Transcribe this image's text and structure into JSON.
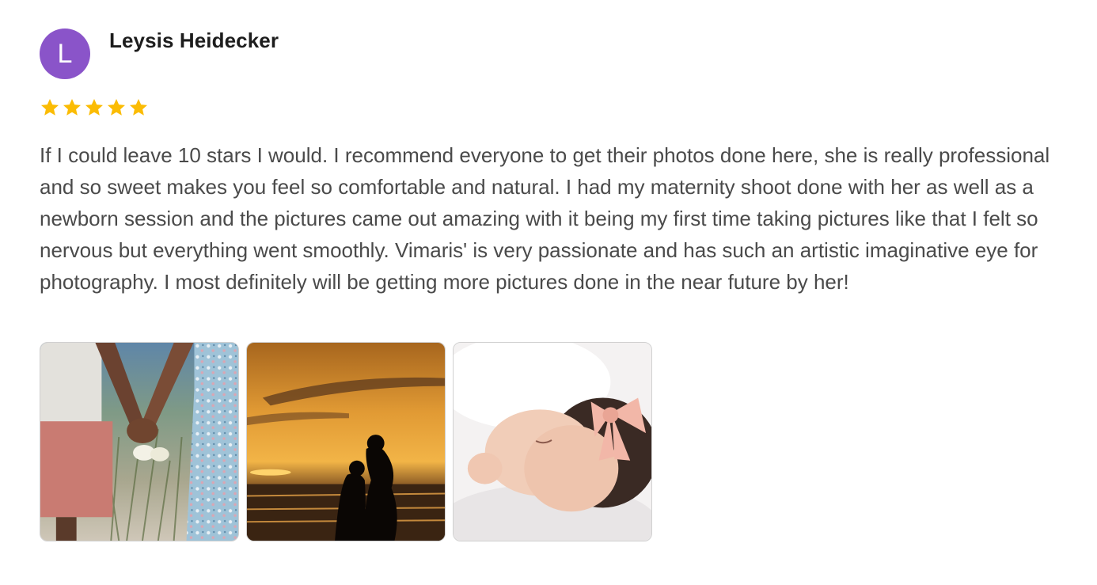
{
  "review": {
    "avatar_initial": "L",
    "avatar_color": "#8a54c9",
    "reviewer_name": "Leysis Heidecker",
    "rating": 5,
    "rating_max": 5,
    "star_color": "#fbbc04",
    "text": "If I could leave 10 stars I would. I recommend everyone to get their photos done here, she is really professional and so sweet makes you feel so comfortable and natural. I had my maternity shoot done with her as well as a newborn session and the pictures came out amazing with it being my first time taking pictures like that I felt so nervous but everything went smoothly. Vimaris' is very passionate and has such an artistic imaginative eye for photography. I most definitely will be getting more pictures done in the near future by her!",
    "photos": [
      {
        "name": "photo-holding-hands-baby-shoes"
      },
      {
        "name": "photo-sunset-maternity-silhouette"
      },
      {
        "name": "photo-newborn-with-bow"
      }
    ]
  }
}
